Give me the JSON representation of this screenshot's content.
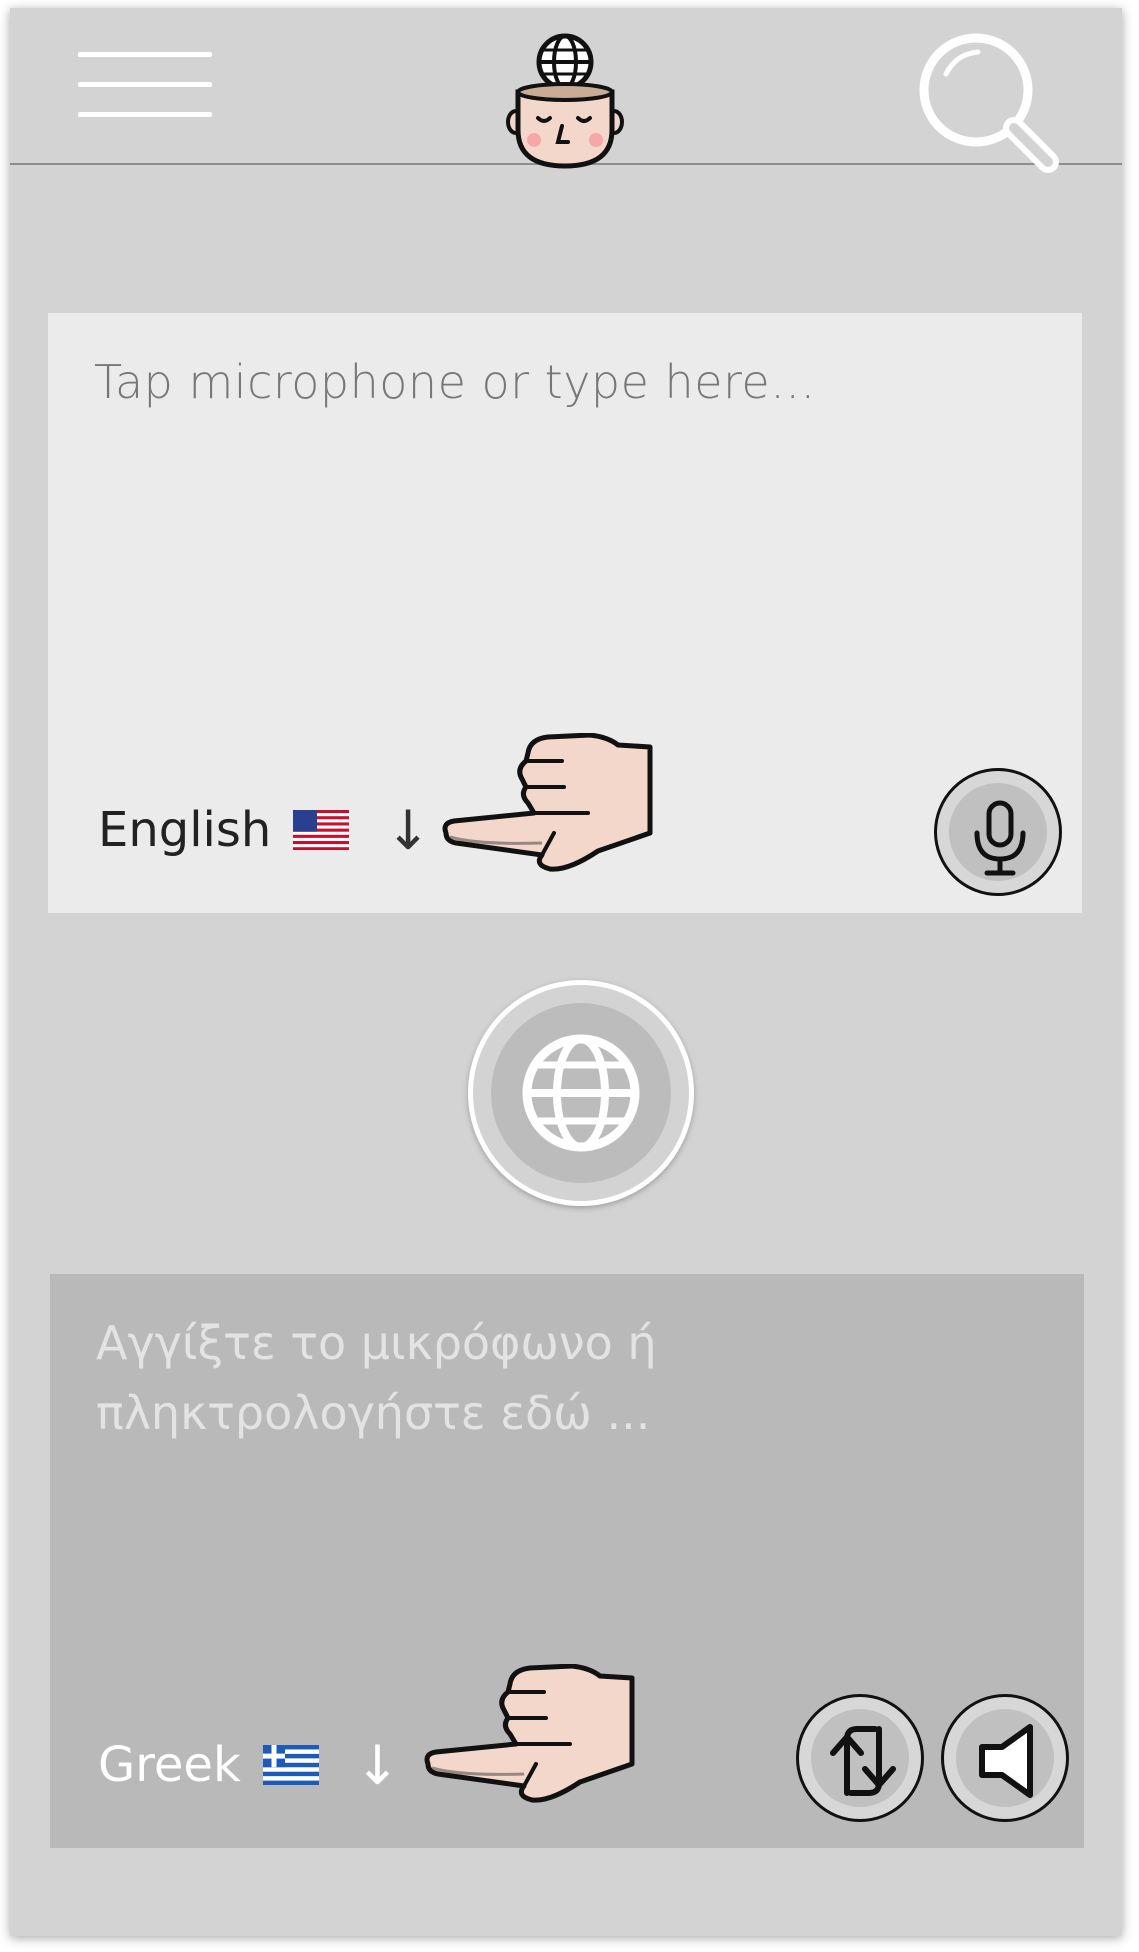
{
  "header": {
    "menu_icon": "hamburger-menu-icon",
    "logo_icon": "head-globe-logo-icon",
    "search_icon": "search-icon"
  },
  "source": {
    "placeholder": "Tap microphone or type here...",
    "language": "English",
    "flag_icon": "us-flag-icon",
    "dropdown_arrow": "↓",
    "mic_icon": "microphone-icon"
  },
  "translate_button": {
    "icon": "globe-icon"
  },
  "target": {
    "placeholder": "Αγγίξτε το μικρόφωνο ή πληκτρολογήστε εδώ ...",
    "language": "Greek",
    "flag_icon": "greek-flag-icon",
    "dropdown_arrow": "↓",
    "swap_icon": "swap-arrows-icon",
    "speaker_icon": "speaker-icon"
  },
  "colors": {
    "background": "#d3d3d3",
    "source_card": "#ebebeb",
    "target_card": "#b9b9b9",
    "hand_skin": "#f4d7cb"
  }
}
